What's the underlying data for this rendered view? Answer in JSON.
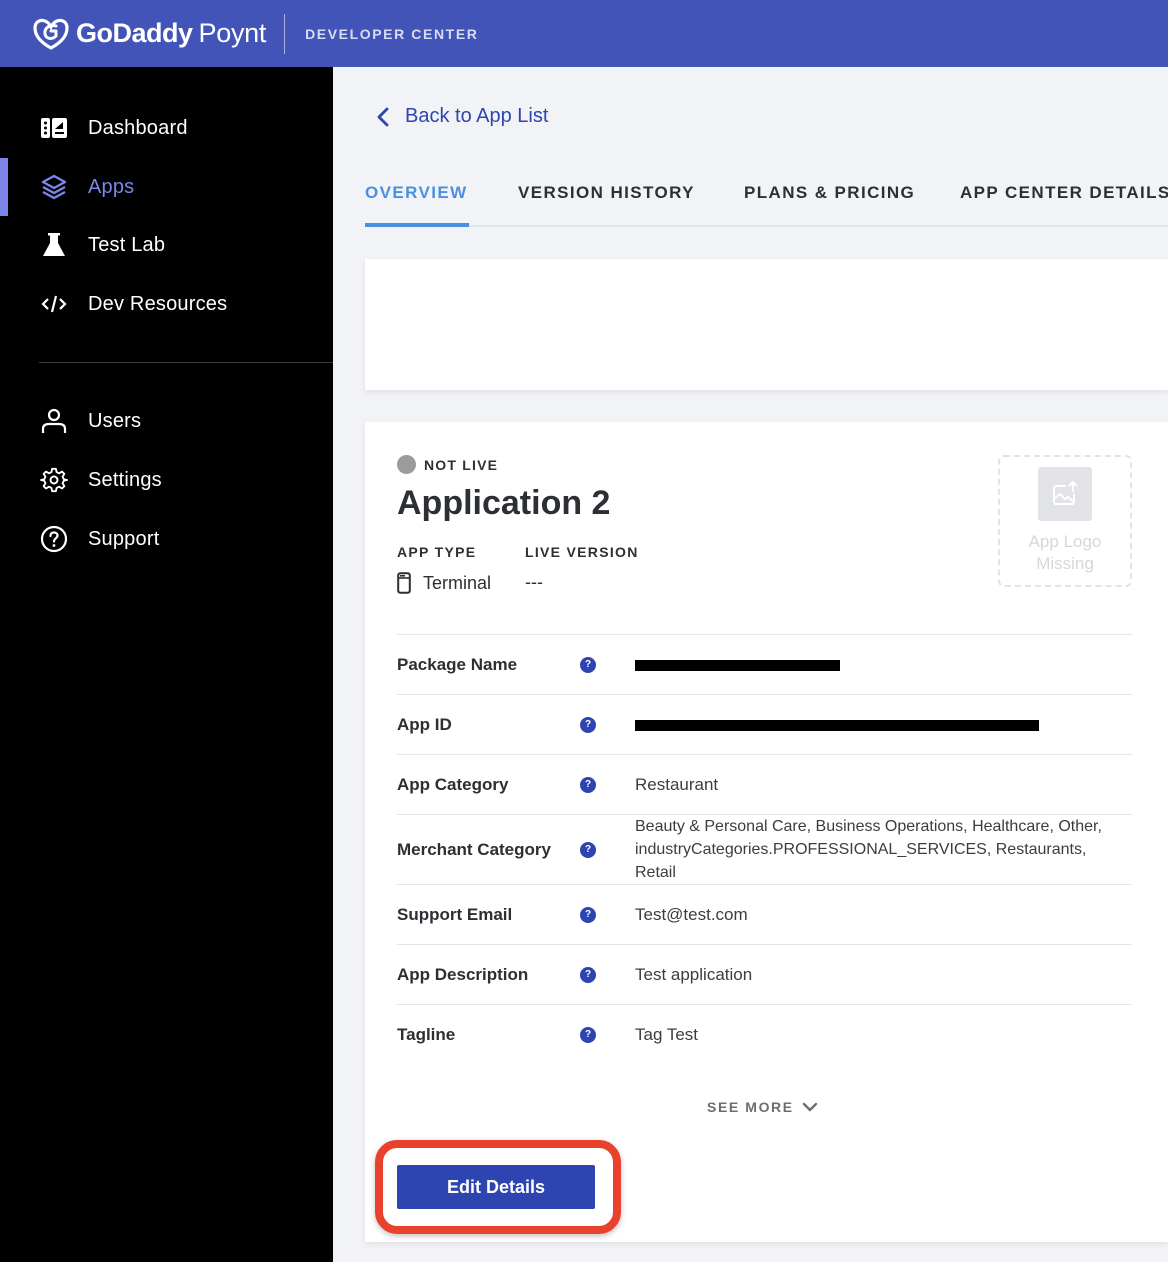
{
  "header": {
    "brand_bold": "GoDaddy",
    "brand_light": "Poynt",
    "section": "DEVELOPER CENTER",
    "colors": {
      "topbar": "#4354b8",
      "accent": "#7b86e8"
    }
  },
  "sidebar": {
    "items": [
      {
        "label": "Dashboard",
        "icon": "dashboard-icon",
        "active": false
      },
      {
        "label": "Apps",
        "icon": "layers-icon",
        "active": true
      },
      {
        "label": "Test Lab",
        "icon": "flask-icon",
        "active": false
      },
      {
        "label": "Dev Resources",
        "icon": "code-icon",
        "active": false
      },
      {
        "label": "Users",
        "icon": "user-icon",
        "active": false
      },
      {
        "label": "Settings",
        "icon": "gear-icon",
        "active": false
      },
      {
        "label": "Support",
        "icon": "help-circle-icon",
        "active": false
      }
    ]
  },
  "main": {
    "back_label": "Back to App List",
    "tabs": [
      {
        "label": "OVERVIEW",
        "active": true
      },
      {
        "label": "VERSION HISTORY",
        "active": false
      },
      {
        "label": "PLANS & PRICING",
        "active": false
      },
      {
        "label": "APP CENTER DETAILS",
        "active": false
      }
    ],
    "app": {
      "status": "NOT LIVE",
      "title": "Application 2",
      "app_type_label": "APP TYPE",
      "app_type_value": "Terminal",
      "live_version_label": "LIVE VERSION",
      "live_version_value": "---",
      "logo_missing": "App Logo Missing"
    },
    "details": [
      {
        "key": "Package Name",
        "value": "[redacted]",
        "redacted": true
      },
      {
        "key": "App ID",
        "value": "[redacted]",
        "redacted": true
      },
      {
        "key": "App Category",
        "value": "Restaurant"
      },
      {
        "key": "Merchant Category",
        "value": "Beauty & Personal Care, Business Operations, Healthcare, Other, industryCategories.PROFESSIONAL_SERVICES, Restaurants, Retail"
      },
      {
        "key": "Support Email",
        "value": "Test@test.com"
      },
      {
        "key": "App Description",
        "value": "Test application"
      },
      {
        "key": "Tagline",
        "value": "Tag Test"
      }
    ],
    "see_more": "SEE MORE",
    "edit_button": "Edit Details",
    "help_glyph": "?"
  }
}
